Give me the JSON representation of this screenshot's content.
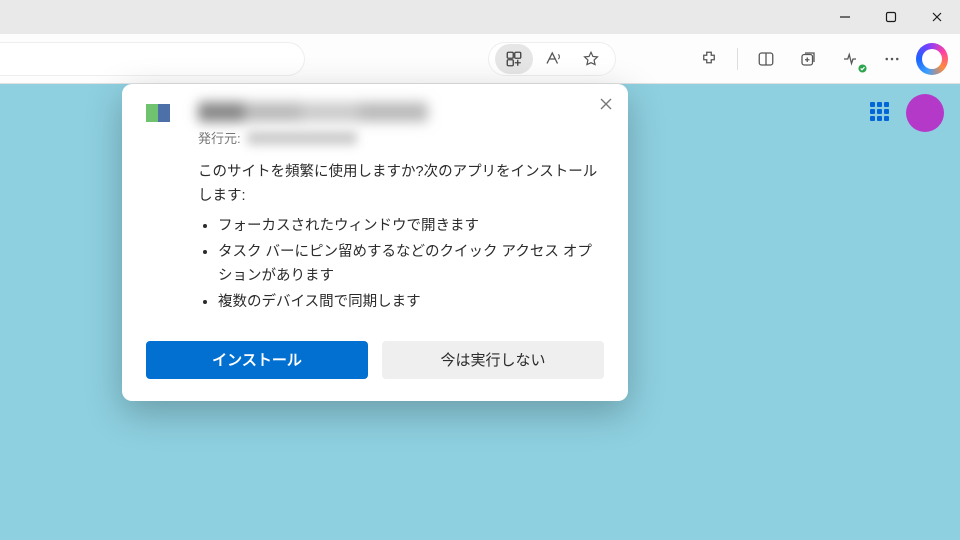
{
  "dialog": {
    "publisher_label": "発行元:",
    "question": "このサイトを頻繁に使用しますか?次のアプリをインストールします:",
    "bullets": [
      "フォーカスされたウィンドウで開きます",
      "タスク バーにピン留めするなどのクイック アクセス オプションがあります",
      "複数のデバイス間で同期します"
    ],
    "install": "インストール",
    "not_now": "今は実行しない"
  }
}
